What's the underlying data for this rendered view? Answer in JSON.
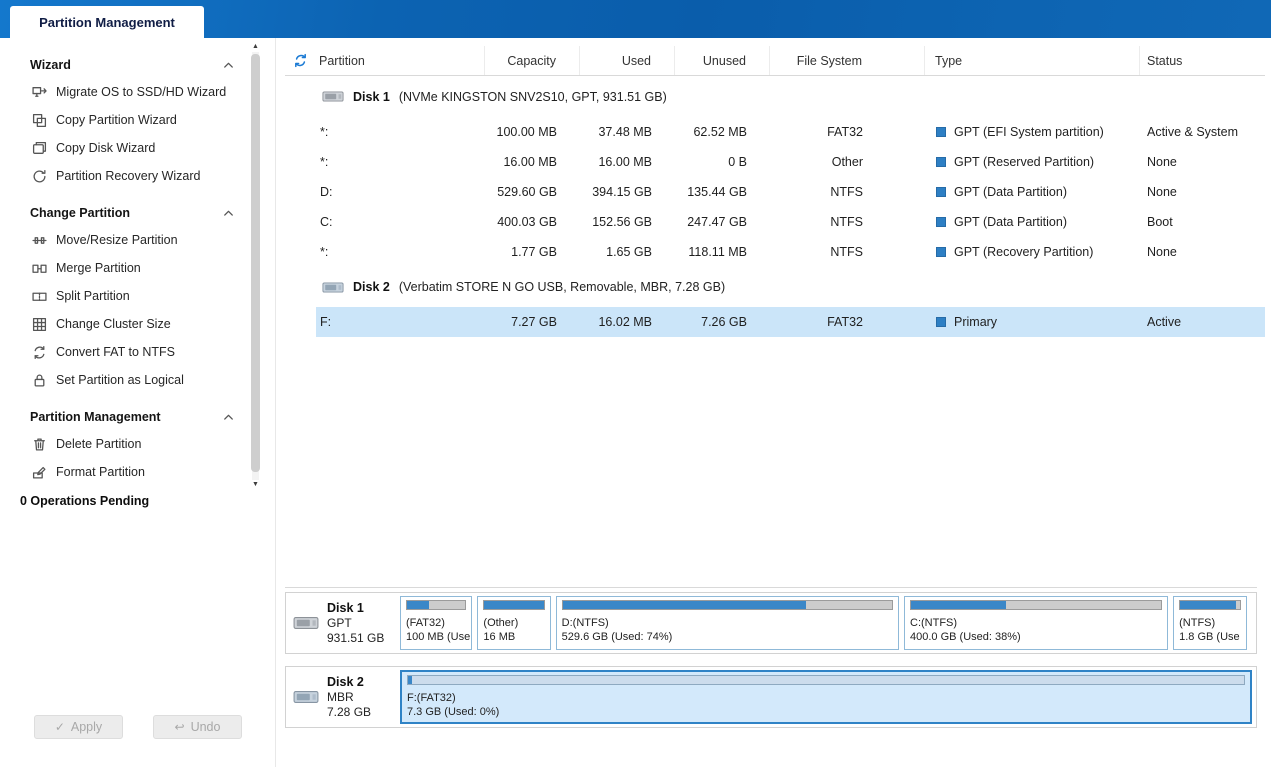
{
  "tab": {
    "title": "Partition Management"
  },
  "sidebar": {
    "sections": [
      {
        "title": "Wizard",
        "items": [
          {
            "label": "Migrate OS to SSD/HD Wizard",
            "icon": "migrate-os-icon"
          },
          {
            "label": "Copy Partition Wizard",
            "icon": "copy-partition-icon"
          },
          {
            "label": "Copy Disk Wizard",
            "icon": "copy-disk-icon"
          },
          {
            "label": "Partition Recovery Wizard",
            "icon": "partition-recovery-icon"
          }
        ]
      },
      {
        "title": "Change Partition",
        "items": [
          {
            "label": "Move/Resize Partition",
            "icon": "move-resize-icon"
          },
          {
            "label": "Merge Partition",
            "icon": "merge-icon"
          },
          {
            "label": "Split Partition",
            "icon": "split-icon"
          },
          {
            "label": "Change Cluster Size",
            "icon": "cluster-size-icon"
          },
          {
            "label": "Convert FAT to NTFS",
            "icon": "convert-icon"
          },
          {
            "label": "Set Partition as Logical",
            "icon": "set-logical-icon"
          }
        ]
      },
      {
        "title": "Partition Management",
        "items": [
          {
            "label": "Delete Partition",
            "icon": "delete-icon"
          },
          {
            "label": "Format Partition",
            "icon": "format-icon"
          }
        ]
      }
    ],
    "pending": "0 Operations Pending",
    "apply": "Apply",
    "undo": "Undo"
  },
  "table": {
    "columns": [
      "Partition",
      "Capacity",
      "Used",
      "Unused",
      "File System",
      "Type",
      "Status"
    ],
    "groups": [
      {
        "disk": "Disk 1",
        "info": "(NVMe KINGSTON SNV2S10, GPT, 931.51 GB)",
        "rows": [
          {
            "partition": "*:",
            "capacity": "100.00 MB",
            "used": "37.48 MB",
            "unused": "62.52 MB",
            "fs": "FAT32",
            "type": "GPT (EFI System partition)",
            "status": "Active & System"
          },
          {
            "partition": "*:",
            "capacity": "16.00 MB",
            "used": "16.00 MB",
            "unused": "0 B",
            "fs": "Other",
            "type": "GPT (Reserved Partition)",
            "status": "None"
          },
          {
            "partition": "D:",
            "capacity": "529.60 GB",
            "used": "394.15 GB",
            "unused": "135.44 GB",
            "fs": "NTFS",
            "type": "GPT (Data Partition)",
            "status": "None"
          },
          {
            "partition": "C:",
            "capacity": "400.03 GB",
            "used": "152.56 GB",
            "unused": "247.47 GB",
            "fs": "NTFS",
            "type": "GPT (Data Partition)",
            "status": "Boot"
          },
          {
            "partition": "*:",
            "capacity": "1.77 GB",
            "used": "1.65 GB",
            "unused": "118.11 MB",
            "fs": "NTFS",
            "type": "GPT (Recovery Partition)",
            "status": "None"
          }
        ]
      },
      {
        "disk": "Disk 2",
        "info": "(Verbatim STORE N GO USB, Removable, MBR, 7.28 GB)",
        "rows": [
          {
            "partition": "F:",
            "capacity": "7.27 GB",
            "used": "16.02 MB",
            "unused": "7.26 GB",
            "fs": "FAT32",
            "type": "Primary",
            "status": "Active",
            "selected": true
          }
        ]
      }
    ]
  },
  "diskmap": {
    "disks": [
      {
        "name": "Disk 1",
        "scheme": "GPT",
        "size": "931.51 GB",
        "blocks": [
          {
            "line1": "(FAT32)",
            "line2": "100 MB (Use",
            "used_pct": 38,
            "width_pct": 8.5
          },
          {
            "line1": "(Other)",
            "line2": "16 MB",
            "used_pct": 100,
            "width_pct": 8.6
          },
          {
            "line1": "D:(NTFS)",
            "line2": "529.6 GB (Used: 74%)",
            "used_pct": 74,
            "width_pct": 40.3
          },
          {
            "line1": "C:(NTFS)",
            "line2": "400.0 GB (Used: 38%)",
            "used_pct": 38,
            "width_pct": 31
          },
          {
            "line1": "(NTFS)",
            "line2": "1.8 GB (Use",
            "used_pct": 93,
            "width_pct": 8.7
          }
        ]
      },
      {
        "name": "Disk 2",
        "scheme": "MBR",
        "size": "7.28 GB",
        "blocks": [
          {
            "line1": "F:(FAT32)",
            "line2": "7.3 GB (Used: 0%)",
            "used_pct": 0.5,
            "width_pct": 100,
            "selected": true
          }
        ]
      }
    ]
  }
}
